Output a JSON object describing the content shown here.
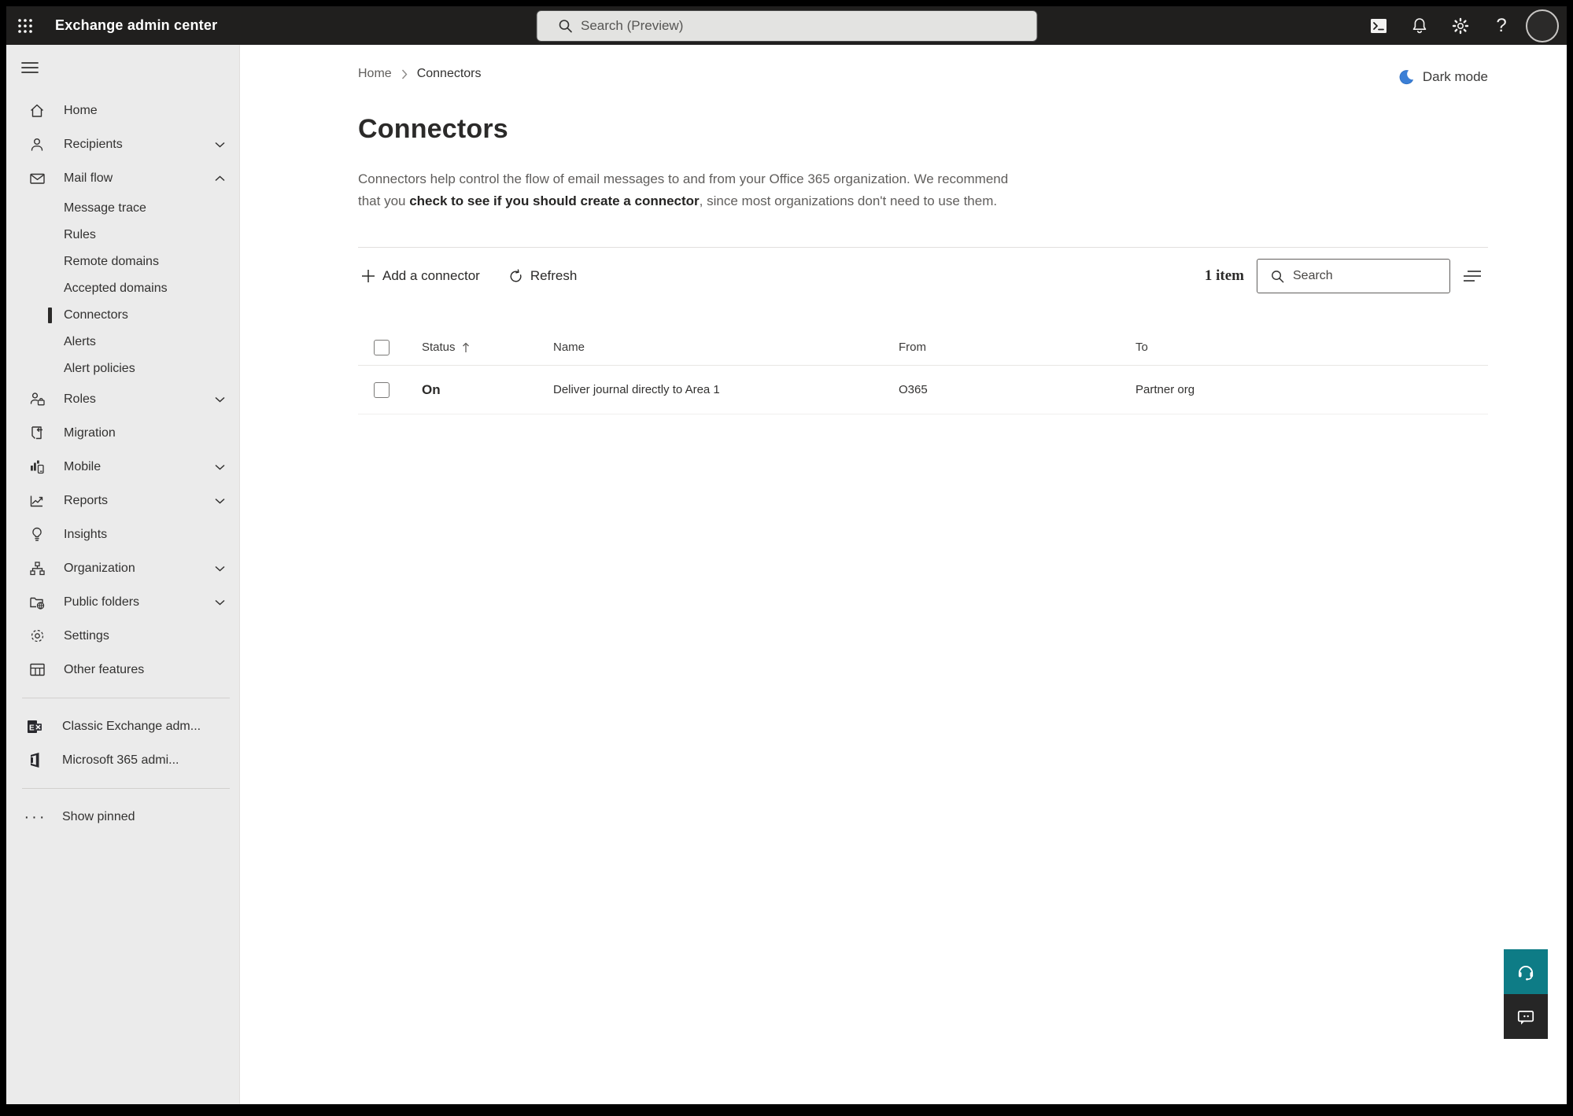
{
  "topbar": {
    "app_title": "Exchange admin center",
    "search_placeholder": "Search (Preview)",
    "icons": [
      "app-launcher-icon",
      "cloud-shell-icon",
      "notifications-icon",
      "settings-icon",
      "help-icon",
      "avatar"
    ]
  },
  "sidebar": {
    "items": [
      {
        "label": "Home",
        "icon": "home-icon"
      },
      {
        "label": "Recipients",
        "icon": "person-icon",
        "chevron": "down"
      },
      {
        "label": "Mail flow",
        "icon": "mail-icon",
        "chevron": "up",
        "expanded": true
      },
      {
        "label": "Message trace",
        "sub": true
      },
      {
        "label": "Rules",
        "sub": true
      },
      {
        "label": "Remote domains",
        "sub": true
      },
      {
        "label": "Accepted domains",
        "sub": true
      },
      {
        "label": "Connectors",
        "sub": true,
        "selected": true
      },
      {
        "label": "Alerts",
        "sub": true
      },
      {
        "label": "Alert policies",
        "sub": true
      },
      {
        "label": "Roles",
        "icon": "roles-icon",
        "chevron": "down"
      },
      {
        "label": "Migration",
        "icon": "migration-icon"
      },
      {
        "label": "Mobile",
        "icon": "mobile-icon",
        "chevron": "down"
      },
      {
        "label": "Reports",
        "icon": "reports-icon",
        "chevron": "down"
      },
      {
        "label": "Insights",
        "icon": "insights-icon"
      },
      {
        "label": "Organization",
        "icon": "organization-icon",
        "chevron": "down"
      },
      {
        "label": "Public folders",
        "icon": "public-folders-icon",
        "chevron": "down"
      },
      {
        "label": "Settings",
        "icon": "gear-icon"
      },
      {
        "label": "Other features",
        "icon": "table-icon"
      }
    ],
    "footer": [
      {
        "label": "Classic Exchange adm...",
        "icon": "exchange-logo"
      },
      {
        "label": "Microsoft 365 admi...",
        "icon": "microsoft-365-logo"
      },
      {
        "label": "Show pinned",
        "icon": "ellipsis-icon"
      }
    ]
  },
  "main": {
    "breadcrumb": {
      "home": "Home",
      "current": "Connectors"
    },
    "dark_mode_label": "Dark mode",
    "title": "Connectors",
    "description": {
      "part1": "Connectors help control the flow of email messages to and from your Office 365 organization. We recommend that you ",
      "link": "check to see if you should create a connector",
      "part2": ", since most organizations don't need to use them."
    },
    "toolbar": {
      "add_label": "Add a connector",
      "refresh_label": "Refresh",
      "item_count": "1 item",
      "search_placeholder": "Search"
    },
    "table": {
      "headers": {
        "status": "Status",
        "name": "Name",
        "from": "From",
        "to": "To"
      },
      "sorted_by": "Status",
      "sort_direction": "asc",
      "rows": [
        {
          "status": "On",
          "name": "Deliver journal directly to Area 1",
          "from": "O365",
          "to": "Partner org"
        }
      ]
    }
  },
  "colors": {
    "topbar_bg": "#201f1e",
    "sidebar_bg": "#ebebeb",
    "accent_blue": "#3b7fd6",
    "help_teal": "#0e7c86",
    "feedback_dark": "#262626",
    "text_primary": "#323130",
    "text_secondary": "#605e5c"
  }
}
